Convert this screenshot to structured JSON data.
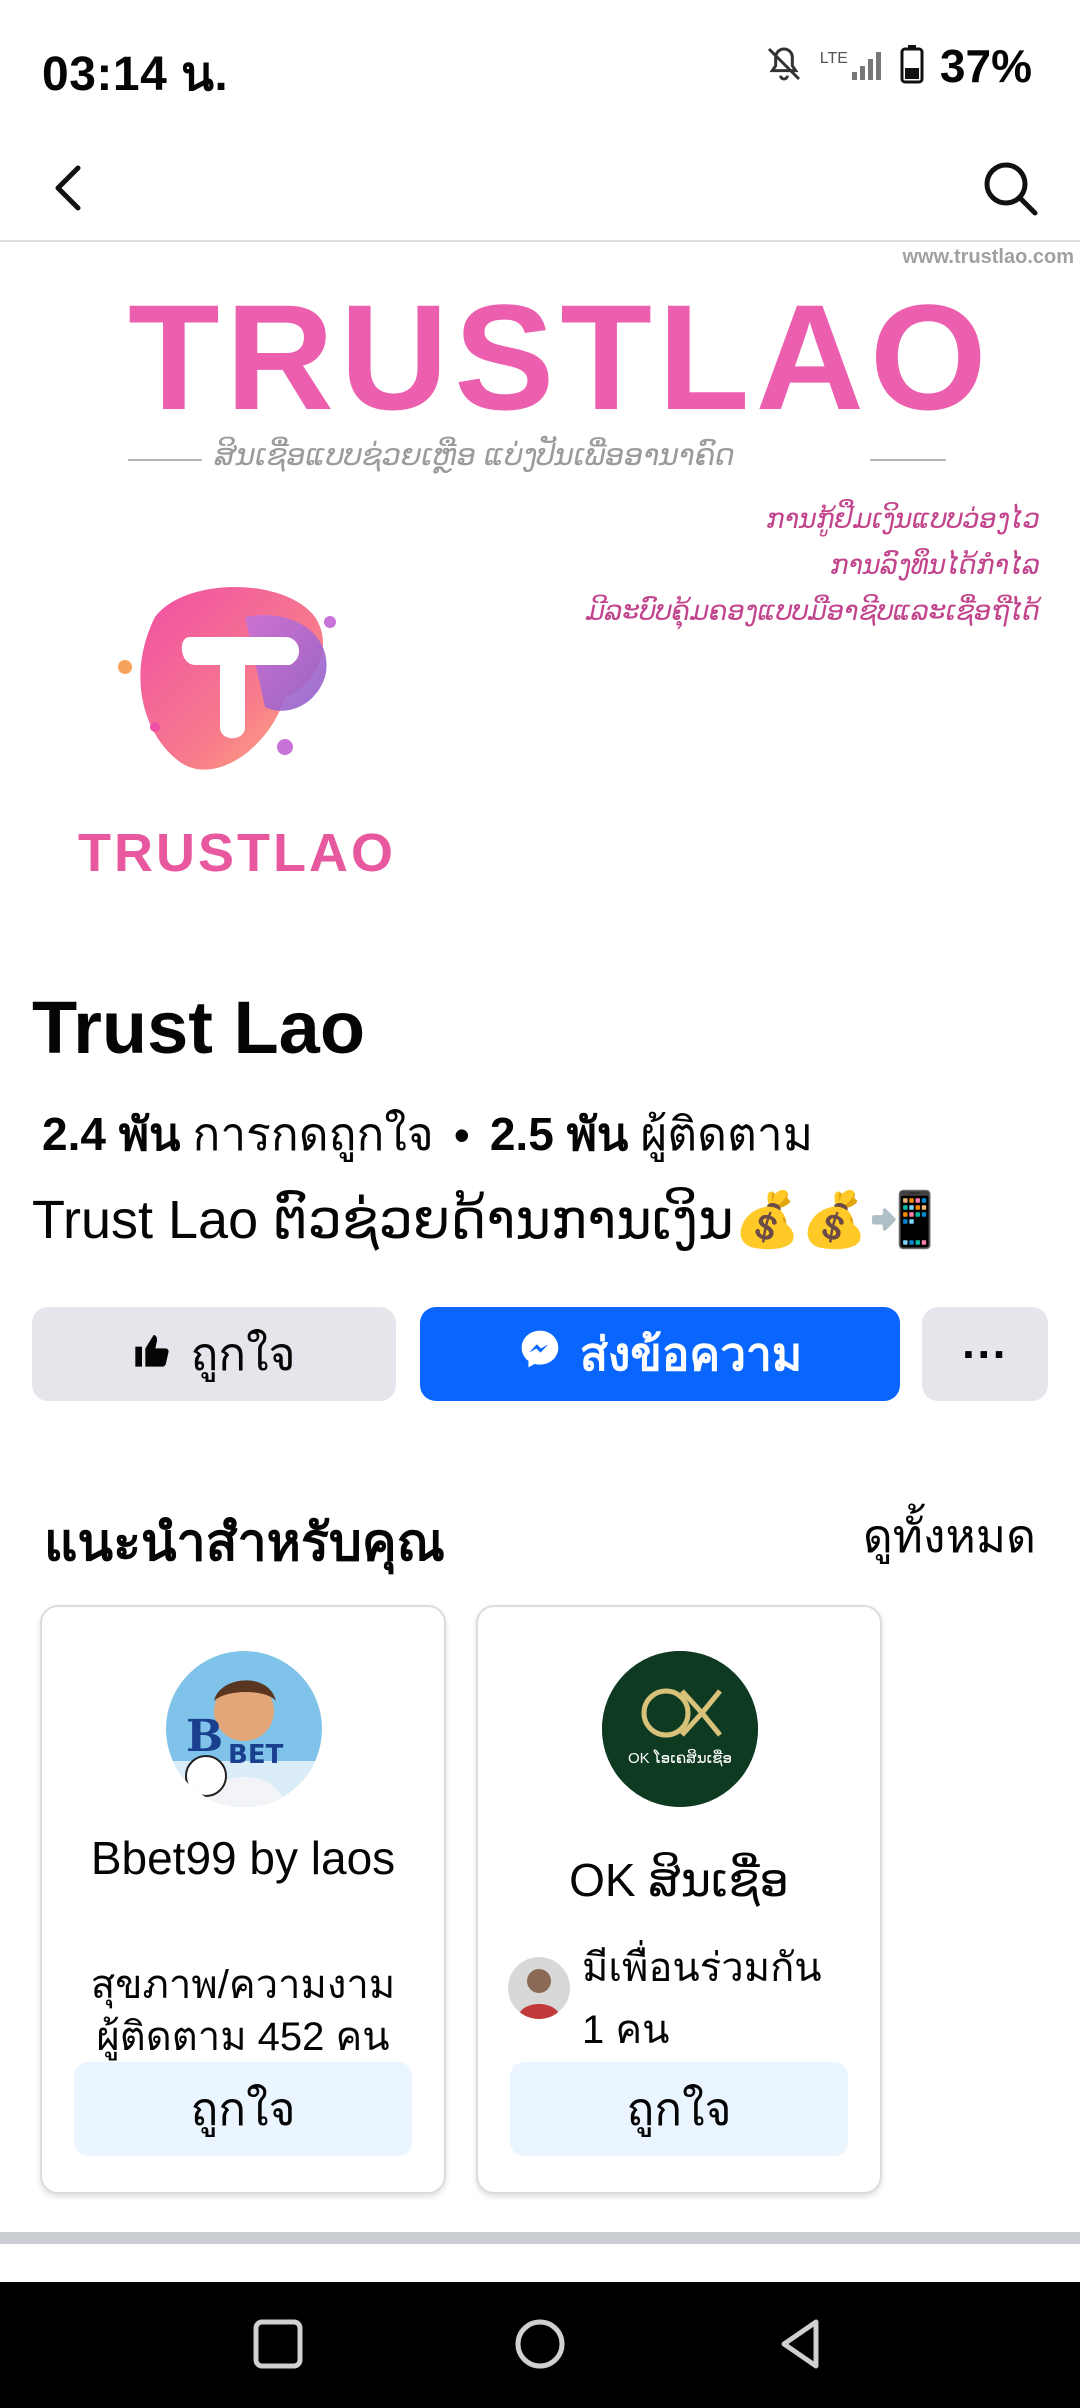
{
  "status_bar": {
    "time": "03:14 น.",
    "battery_percent": "37%",
    "network_label": "LTE",
    "icons": [
      "bell-muted-icon",
      "signal-icon",
      "battery-icon"
    ]
  },
  "nav": {
    "back_icon": "chevron-left-icon",
    "search_icon": "search-icon"
  },
  "cover": {
    "site": "www.trustlao.com",
    "brand": "TRUSTLAO",
    "slogan": "ສິນເຊື່ອແບບຊ່ວຍເຫຼືອ ແບ່ງປັນເພື່ອອານາຄົດ",
    "taglines": [
      "ການກູ້ຢືມເງິນແບບວ່ອງໄວ",
      "ການລົງທຶນໄດ້ກຳໄລ",
      "ມີລະບົບຄຸ້ມຄອງແບບມືອາຊີບແລະເຊື່ອຖືໄດ້"
    ],
    "logo_text": "TRUSTLAO"
  },
  "page": {
    "name": "Trust Lao",
    "likes_count": "2.4 พัน",
    "likes_label": "การกดถูกใจ",
    "separator": "•",
    "followers_count": "2.5 พัน",
    "followers_label": "ผู้ติดตาม",
    "description": "Trust Lao ຕົວຊ່ວຍດ້ານການເງິນ💰💰📲"
  },
  "actions": {
    "like_label": "ถูกใจ",
    "message_label": "ส่งข้อความ",
    "more_label": "···",
    "accent": "#0866ff"
  },
  "suggestions": {
    "title": "แนะนำสำหรับคุณ",
    "see_all": "ดูทั้งหมด",
    "cards": [
      {
        "name": "Bbet99 by laos",
        "category": "สุขภาพ/ความงาม",
        "followers": "ผู้ติดตาม 452 คน",
        "button": "ถูกใจ"
      },
      {
        "name": "OK ສິນເຊື່ອ",
        "mutual": "มีเพื่อนร่วมกัน 1 คน",
        "avatar_text": "OK ໂອເຄສິນເຊື່ອ",
        "button": "ถูกใจ"
      }
    ]
  },
  "system_nav": {
    "icons": [
      "recent-apps-icon",
      "home-icon",
      "back-icon"
    ]
  }
}
